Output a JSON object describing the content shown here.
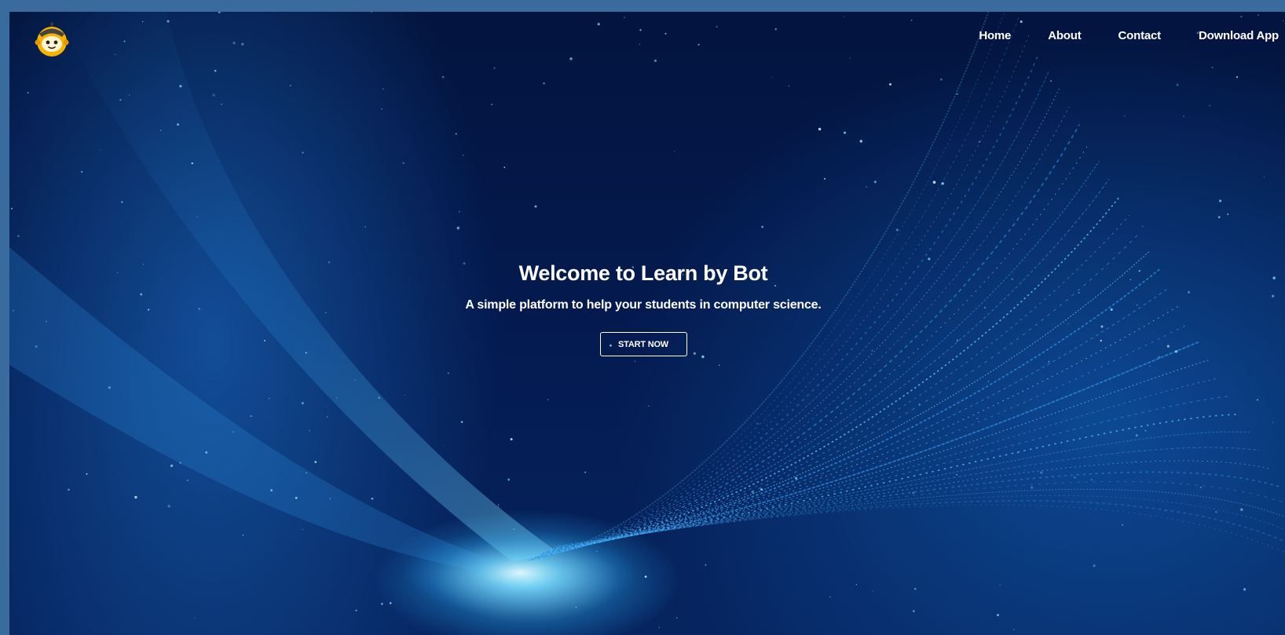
{
  "nav": {
    "logo_icon": "robot-mascot-icon",
    "links": [
      {
        "label": "Home"
      },
      {
        "label": "About"
      },
      {
        "label": "Contact"
      },
      {
        "label": "Download App"
      }
    ]
  },
  "hero": {
    "title": "Welcome to Learn by Bot",
    "subtitle": "A simple platform to help your students in computer science.",
    "cta_label": "START NOW"
  },
  "colors": {
    "frame_border": "#3a6b9f",
    "background_dark": "#041a4f",
    "glow": "#5fd0ff",
    "logo_yellow": "#f5b400",
    "text": "#ffffff"
  }
}
